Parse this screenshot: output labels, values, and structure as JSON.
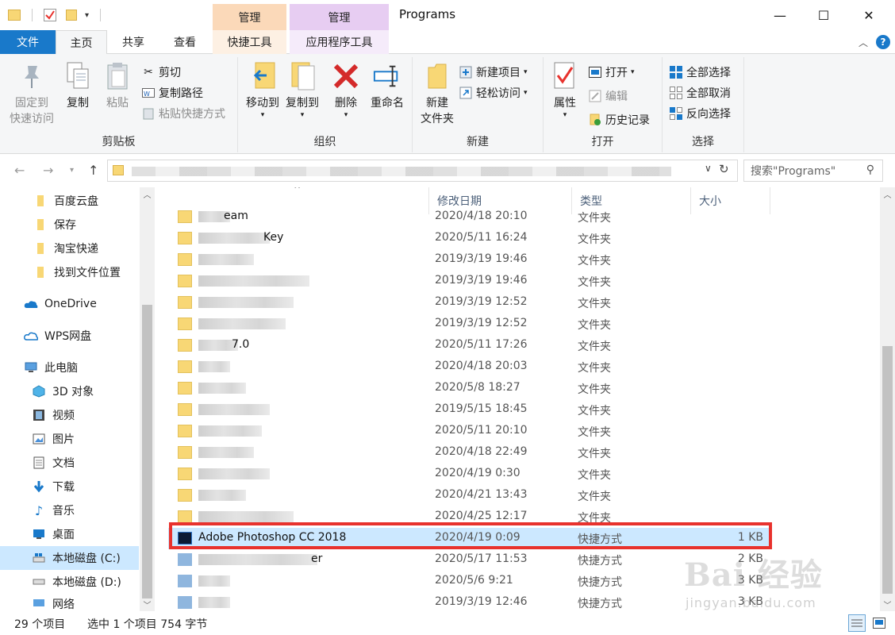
{
  "title_bar": {
    "context_tab_1": "管理",
    "context_tab_2": "管理",
    "window_title": "Programs",
    "minimize": "—",
    "maximize": "☐",
    "close": "✕"
  },
  "ribbon_tabs": {
    "file": "文件",
    "home": "主页",
    "share": "共享",
    "view": "查看",
    "shortcut_tools": "快捷工具",
    "app_tools": "应用程序工具"
  },
  "ribbon": {
    "clipboard": {
      "label": "剪贴板",
      "pin_line1": "固定到",
      "pin_line2": "快速访问",
      "copy": "复制",
      "paste": "粘贴",
      "cut": "剪切",
      "copy_path": "复制路径",
      "paste_shortcut": "粘贴快捷方式"
    },
    "organize": {
      "label": "组织",
      "move_to": "移动到",
      "copy_to": "复制到",
      "delete": "删除",
      "rename": "重命名"
    },
    "new": {
      "label": "新建",
      "new_folder_line1": "新建",
      "new_folder_line2": "文件夹",
      "new_item": "新建项目",
      "easy_access": "轻松访问"
    },
    "open": {
      "label": "打开",
      "properties": "属性",
      "open": "打开",
      "edit": "编辑",
      "history": "历史记录"
    },
    "select": {
      "label": "选择",
      "select_all": "全部选择",
      "select_none": "全部取消",
      "invert": "反向选择"
    }
  },
  "search": {
    "placeholder": "搜索\"Programs\""
  },
  "nav_pane": {
    "items": [
      {
        "label": "百度云盘"
      },
      {
        "label": "保存"
      },
      {
        "label": "淘宝快递"
      },
      {
        "label": "找到文件位置"
      },
      {
        "label": "OneDrive"
      },
      {
        "label": "WPS网盘"
      },
      {
        "label": "此电脑"
      },
      {
        "label": "3D 对象"
      },
      {
        "label": "视频"
      },
      {
        "label": "图片"
      },
      {
        "label": "文档"
      },
      {
        "label": "下载"
      },
      {
        "label": "音乐"
      },
      {
        "label": "桌面"
      },
      {
        "label": "本地磁盘 (C:)"
      },
      {
        "label": "本地磁盘 (D:)"
      },
      {
        "label": "网络"
      }
    ]
  },
  "columns": {
    "date": "修改日期",
    "type": "类型",
    "size": "大小"
  },
  "rows": [
    {
      "name": "eam",
      "date": "2020/4/18 20:10",
      "type": "文件夹",
      "size": ""
    },
    {
      "name": "Key",
      "date": "2020/5/11 16:24",
      "type": "文件夹",
      "size": ""
    },
    {
      "name": "",
      "date": "2019/3/19 19:46",
      "type": "文件夹",
      "size": ""
    },
    {
      "name": "",
      "date": "2019/3/19 19:46",
      "type": "文件夹",
      "size": ""
    },
    {
      "name": "",
      "date": "2019/3/19 12:52",
      "type": "文件夹",
      "size": ""
    },
    {
      "name": "",
      "date": "2019/3/19 12:52",
      "type": "文件夹",
      "size": ""
    },
    {
      "name": "7.0",
      "date": "2020/5/11 17:26",
      "type": "文件夹",
      "size": ""
    },
    {
      "name": "",
      "date": "2020/4/18 20:03",
      "type": "文件夹",
      "size": ""
    },
    {
      "name": "",
      "date": "2020/5/8 18:27",
      "type": "文件夹",
      "size": ""
    },
    {
      "name": "",
      "date": "2019/5/15 18:45",
      "type": "文件夹",
      "size": ""
    },
    {
      "name": "",
      "date": "2020/5/11 20:10",
      "type": "文件夹",
      "size": ""
    },
    {
      "name": "",
      "date": "2020/4/18 22:49",
      "type": "文件夹",
      "size": ""
    },
    {
      "name": "",
      "date": "2020/4/19 0:30",
      "type": "文件夹",
      "size": ""
    },
    {
      "name": "",
      "date": "2020/4/21 13:43",
      "type": "文件夹",
      "size": ""
    },
    {
      "name": "",
      "date": "2020/4/25 12:17",
      "type": "文件夹",
      "size": ""
    },
    {
      "name": "Adobe Photoshop CC 2018",
      "date": "2020/4/19 0:09",
      "type": "快捷方式",
      "size": "1 KB"
    },
    {
      "name": "er",
      "date": "2020/5/17 11:53",
      "type": "快捷方式",
      "size": "2 KB"
    },
    {
      "name": "",
      "date": "2020/5/6 9:21",
      "type": "快捷方式",
      "size": "3 KB"
    },
    {
      "name": "",
      "date": "2019/3/19 12:46",
      "type": "快捷方式",
      "size": "3 KB"
    }
  ],
  "status_bar": {
    "item_count": "29 个项目",
    "selection": "选中 1 个项目  754 字节"
  },
  "watermark": {
    "brand": "Bai  经验",
    "url": "jingyan.baidu.com"
  },
  "colors": {
    "file_tab": "#1979ca",
    "selection": "#cce8ff",
    "highlight_border": "#e8322d",
    "folder": "#f8d775"
  }
}
